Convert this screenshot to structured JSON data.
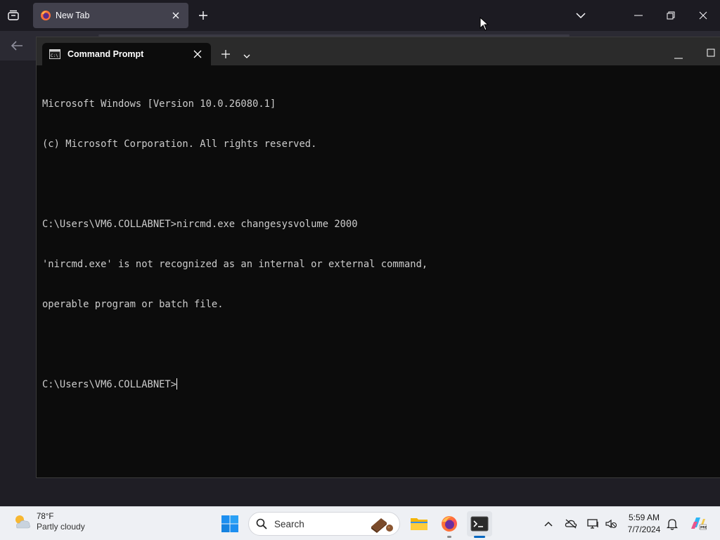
{
  "browser": {
    "tab_label": "New Tab",
    "accent": "#42414d"
  },
  "terminal": {
    "tab_label": "Command Prompt",
    "lines": [
      "Microsoft Windows [Version 10.0.26080.1]",
      "(c) Microsoft Corporation. All rights reserved.",
      "",
      "C:\\Users\\VM6.COLLABNET>nircmd.exe changesysvolume 2000",
      "'nircmd.exe' is not recognized as an internal or external command,",
      "operable program or batch file.",
      "",
      "C:\\Users\\VM6.COLLABNET>"
    ],
    "background": "#0c0c0c",
    "text_color": "#cccccc"
  },
  "taskbar": {
    "weather_temp": "78°F",
    "weather_condition": "Partly cloudy",
    "search_placeholder": "Search",
    "clock_time": "5:59 AM",
    "clock_date": "7/7/2024",
    "apps": [
      "start-icon",
      "file-explorer-icon",
      "firefox-icon",
      "terminal-icon"
    ],
    "tray": [
      "chevron-up-icon",
      "onedrive-offline-icon",
      "display-icon",
      "volume-muted-icon",
      "bell-icon",
      "copilot-icon"
    ]
  }
}
